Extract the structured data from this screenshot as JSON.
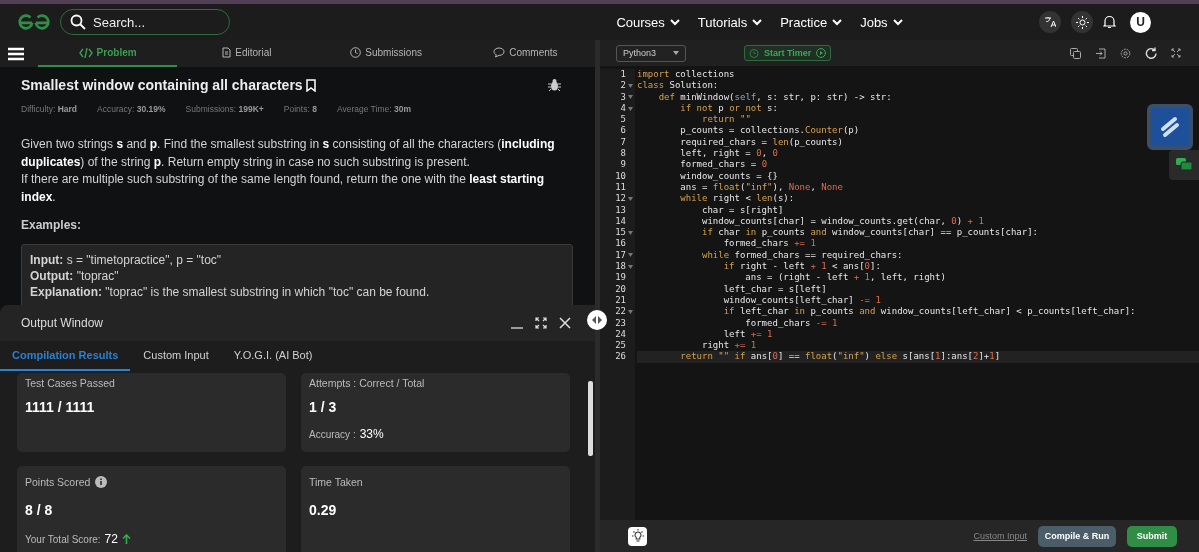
{
  "header": {
    "search": {
      "placeholder": "Search..."
    },
    "nav": [
      "Courses",
      "Tutorials",
      "Practice",
      "Jobs"
    ],
    "avatar": "U"
  },
  "problem_tabs": [
    {
      "label": "Problem",
      "selected": true
    },
    {
      "label": "Editorial",
      "selected": false
    },
    {
      "label": "Submissions",
      "selected": false
    },
    {
      "label": "Comments",
      "selected": false
    }
  ],
  "problem": {
    "title": "Smallest window containing all characters",
    "meta": [
      {
        "label": "Difficulty:",
        "value": "Hard"
      },
      {
        "label": "Accuracy:",
        "value": "30.19%"
      },
      {
        "label": "Submissions:",
        "value": "199K+"
      },
      {
        "label": "Points:",
        "value": "8"
      },
      {
        "label": "Average Time:",
        "value": "30m"
      }
    ],
    "description": [
      "Given two strings **s** and **p**. Find the smallest substring in **s** consisting of all the characters (**including duplicates**) of the string **p**. Return empty string in case no such substring is present.",
      "If there are multiple such substring of the same length found, return the one with the **least starting index**."
    ],
    "examples_heading": "Examples:",
    "example": [
      "**Input:** s = \"timetopractice\", p = \"toc\"",
      "**Output:** \"toprac\"",
      "**Explanation:** \"toprac\" is the smallest substring in which \"toc\" can be found."
    ]
  },
  "output_window": {
    "title": "Output Window",
    "tabs": [
      {
        "label": "Compilation Results",
        "selected": true
      },
      {
        "label": "Custom Input",
        "selected": false
      },
      {
        "label": "Y.O.G.I. (AI Bot)",
        "selected": false
      }
    ],
    "cards": [
      {
        "label": "Test Cases Passed",
        "value": "1111 / 1111"
      },
      {
        "label": "Attempts : Correct / Total",
        "value": "1 / 3",
        "extra_label": "Accuracy :",
        "extra_value": "33%"
      },
      {
        "label": "Points Scored",
        "info": true,
        "value": "8 / 8",
        "extra_label": "Your Total Score:",
        "extra_value": "72",
        "trend_up": true
      },
      {
        "label": "Time Taken",
        "value": "0.29"
      }
    ]
  },
  "editor": {
    "language": "Python3",
    "timer": "Start Timer",
    "lines": [
      {
        "number": "1",
        "fold": false,
        "active": false,
        "tokens": [
          {
            "kind": "kw",
            "text": "import"
          },
          {
            "kind": "plain",
            "text": " collections"
          }
        ]
      },
      {
        "number": "2",
        "fold": true,
        "active": false,
        "tokens": [
          {
            "kind": "kw",
            "text": "class"
          },
          {
            "kind": "plain",
            "text": " Solution:"
          }
        ]
      },
      {
        "number": "3",
        "fold": true,
        "active": false,
        "tokens": [
          {
            "kind": "kw",
            "text": "    def"
          },
          {
            "kind": "plain",
            "text": " minWindow("
          },
          {
            "kind": "self",
            "text": "self"
          },
          {
            "kind": "plain",
            "text": ", s: str, p: str) -> str:"
          }
        ]
      },
      {
        "number": "4",
        "fold": true,
        "active": false,
        "tokens": [
          {
            "kind": "kw",
            "text": "        if not"
          },
          {
            "kind": "plain",
            "text": " p "
          },
          {
            "kind": "kw",
            "text": "or not"
          },
          {
            "kind": "plain",
            "text": " s:"
          }
        ]
      },
      {
        "number": "5",
        "fold": false,
        "active": false,
        "tokens": [
          {
            "kind": "kw",
            "text": "            return"
          },
          {
            "kind": "str",
            "text": " \"\""
          }
        ]
      },
      {
        "number": "6",
        "fold": false,
        "active": false,
        "tokens": [
          {
            "kind": "plain",
            "text": "        p_counts = collections."
          },
          {
            "kind": "fn",
            "text": "Counter"
          },
          {
            "kind": "plain",
            "text": "(p)"
          }
        ]
      },
      {
        "number": "7",
        "fold": false,
        "active": false,
        "tokens": [
          {
            "kind": "plain",
            "text": "        required_chars = "
          },
          {
            "kind": "fn",
            "text": "len"
          },
          {
            "kind": "plain",
            "text": "(p_counts)"
          }
        ]
      },
      {
        "number": "8",
        "fold": false,
        "active": false,
        "tokens": [
          {
            "kind": "plain",
            "text": "        left, right = "
          },
          {
            "kind": "num",
            "text": "0"
          },
          {
            "kind": "plain",
            "text": ", "
          },
          {
            "kind": "num",
            "text": "0"
          }
        ]
      },
      {
        "number": "9",
        "fold": false,
        "active": false,
        "tokens": [
          {
            "kind": "plain",
            "text": "        formed_chars = "
          },
          {
            "kind": "num",
            "text": "0"
          }
        ]
      },
      {
        "number": "10",
        "fold": false,
        "active": false,
        "tokens": [
          {
            "kind": "plain",
            "text": "        window_counts = {}"
          }
        ]
      },
      {
        "number": "11",
        "fold": false,
        "active": false,
        "tokens": [
          {
            "kind": "plain",
            "text": "        ans = "
          },
          {
            "kind": "fn",
            "text": "float"
          },
          {
            "kind": "plain",
            "text": "("
          },
          {
            "kind": "str",
            "text": "\"inf\""
          },
          {
            "kind": "plain",
            "text": "), "
          },
          {
            "kind": "num",
            "text": "None"
          },
          {
            "kind": "plain",
            "text": ", "
          },
          {
            "kind": "num",
            "text": "None"
          }
        ]
      },
      {
        "number": "12",
        "fold": true,
        "active": false,
        "tokens": [
          {
            "kind": "kw",
            "text": "        while"
          },
          {
            "kind": "plain",
            "text": " right < "
          },
          {
            "kind": "fn",
            "text": "len"
          },
          {
            "kind": "plain",
            "text": "(s):"
          }
        ]
      },
      {
        "number": "13",
        "fold": false,
        "active": false,
        "tokens": [
          {
            "kind": "plain",
            "text": "            char = s[right]"
          }
        ]
      },
      {
        "number": "14",
        "fold": false,
        "active": false,
        "tokens": [
          {
            "kind": "plain",
            "text": "            window_counts[char] = window_counts.get(char, "
          },
          {
            "kind": "num",
            "text": "0"
          },
          {
            "kind": "plain",
            "text": ") "
          },
          {
            "kind": "num",
            "text": "+ 1"
          }
        ]
      },
      {
        "number": "15",
        "fold": true,
        "active": false,
        "tokens": [
          {
            "kind": "kw",
            "text": "            if"
          },
          {
            "kind": "plain",
            "text": " char "
          },
          {
            "kind": "kw",
            "text": "in"
          },
          {
            "kind": "plain",
            "text": " p_counts "
          },
          {
            "kind": "kw",
            "text": "and"
          },
          {
            "kind": "plain",
            "text": " window_counts[char] == p_counts[char]:"
          }
        ]
      },
      {
        "number": "16",
        "fold": false,
        "active": false,
        "tokens": [
          {
            "kind": "plain",
            "text": "                formed_chars "
          },
          {
            "kind": "num",
            "text": "+= 1"
          }
        ]
      },
      {
        "number": "17",
        "fold": true,
        "active": false,
        "tokens": [
          {
            "kind": "kw",
            "text": "            while"
          },
          {
            "kind": "plain",
            "text": " formed_chars == required_chars:"
          }
        ]
      },
      {
        "number": "18",
        "fold": true,
        "active": false,
        "tokens": [
          {
            "kind": "kw",
            "text": "                if"
          },
          {
            "kind": "plain",
            "text": " right - left "
          },
          {
            "kind": "num",
            "text": "+ 1"
          },
          {
            "kind": "plain",
            "text": " < ans["
          },
          {
            "kind": "num",
            "text": "0"
          },
          {
            "kind": "plain",
            "text": "]:"
          }
        ]
      },
      {
        "number": "19",
        "fold": false,
        "active": false,
        "tokens": [
          {
            "kind": "plain",
            "text": "                    ans = (right - left "
          },
          {
            "kind": "num",
            "text": "+ 1"
          },
          {
            "kind": "plain",
            "text": ", left, right)"
          }
        ]
      },
      {
        "number": "20",
        "fold": false,
        "active": false,
        "tokens": [
          {
            "kind": "plain",
            "text": "                left_char = s[left]"
          }
        ]
      },
      {
        "number": "21",
        "fold": false,
        "active": false,
        "tokens": [
          {
            "kind": "plain",
            "text": "                window_counts[left_char] "
          },
          {
            "kind": "num",
            "text": "-= 1"
          }
        ]
      },
      {
        "number": "22",
        "fold": true,
        "active": false,
        "tokens": [
          {
            "kind": "kw",
            "text": "                if"
          },
          {
            "kind": "plain",
            "text": " left_char "
          },
          {
            "kind": "kw",
            "text": "in"
          },
          {
            "kind": "plain",
            "text": " p_counts "
          },
          {
            "kind": "kw",
            "text": "and"
          },
          {
            "kind": "plain",
            "text": " window_counts[left_char] < p_counts[left_char]:"
          }
        ]
      },
      {
        "number": "23",
        "fold": false,
        "active": false,
        "tokens": [
          {
            "kind": "plain",
            "text": "                    formed_chars "
          },
          {
            "kind": "num",
            "text": "-= 1"
          }
        ]
      },
      {
        "number": "24",
        "fold": false,
        "active": false,
        "tokens": [
          {
            "kind": "plain",
            "text": "                left "
          },
          {
            "kind": "num",
            "text": "+= 1"
          }
        ]
      },
      {
        "number": "25",
        "fold": false,
        "active": false,
        "tokens": [
          {
            "kind": "plain",
            "text": "            right "
          },
          {
            "kind": "num",
            "text": "+= 1"
          }
        ]
      },
      {
        "number": "26",
        "fold": false,
        "active": true,
        "tokens": [
          {
            "kind": "kw",
            "text": "        return"
          },
          {
            "kind": "str",
            "text": " \"\""
          },
          {
            "kind": "kw",
            "text": " if"
          },
          {
            "kind": "plain",
            "text": " ans["
          },
          {
            "kind": "num",
            "text": "0"
          },
          {
            "kind": "plain",
            "text": "] == "
          },
          {
            "kind": "fn",
            "text": "float"
          },
          {
            "kind": "plain",
            "text": "("
          },
          {
            "kind": "str",
            "text": "\"inf\""
          },
          {
            "kind": "plain",
            "text": ") "
          },
          {
            "kind": "kw",
            "text": "else"
          },
          {
            "kind": "plain",
            "text": " s[ans["
          },
          {
            "kind": "num",
            "text": "1"
          },
          {
            "kind": "plain",
            "text": "]:ans["
          },
          {
            "kind": "num",
            "text": "2"
          },
          {
            "kind": "plain",
            "text": "]+"
          },
          {
            "kind": "num",
            "text": "1"
          },
          {
            "kind": "plain",
            "text": "]"
          }
        ]
      }
    ]
  },
  "footer": {
    "link": "Custom Input",
    "buttons": [
      "Compile & Run",
      "Submit"
    ]
  }
}
